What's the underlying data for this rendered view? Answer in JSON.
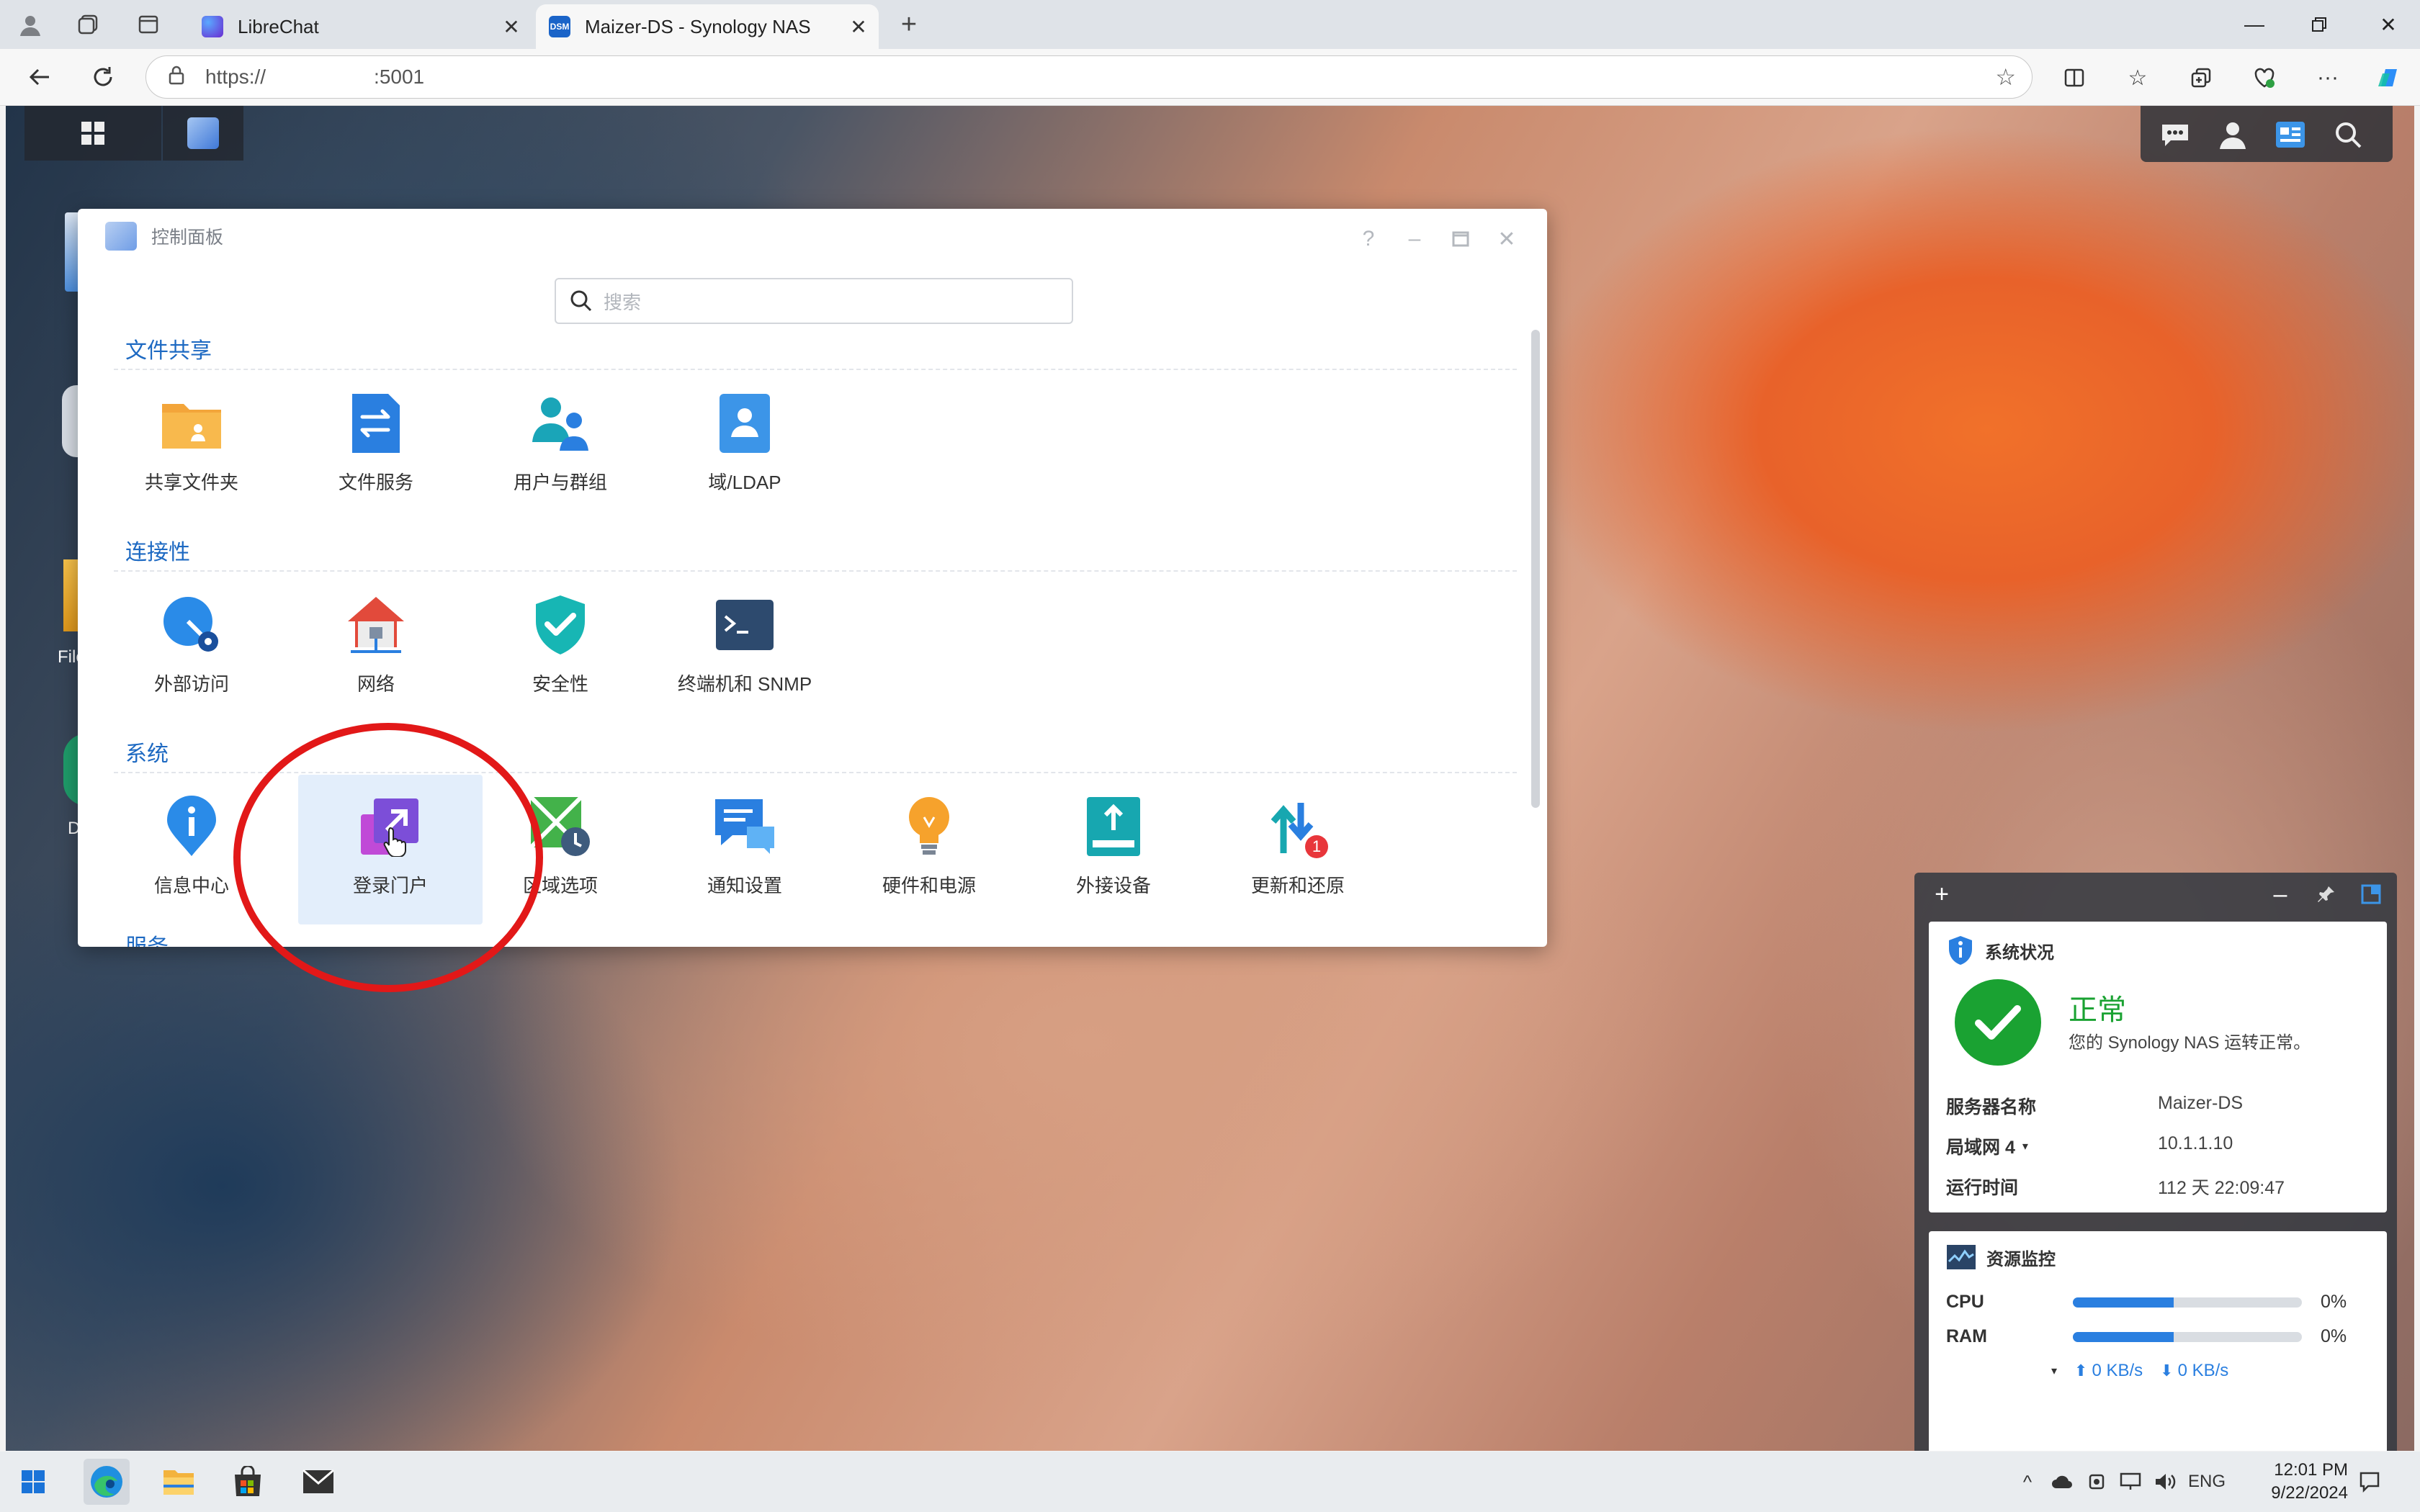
{
  "browser": {
    "tabs": [
      {
        "title": "LibreChat",
        "active": false
      },
      {
        "title": "Maizer-DS - Synology NAS",
        "active": true
      }
    ],
    "url_scheme": "https://",
    "url_port": ":5001"
  },
  "control_panel": {
    "title": "控制面板",
    "search_placeholder": "搜索",
    "sections": [
      {
        "title": "文件共享",
        "items": [
          "共享文件夹",
          "文件服务",
          "用户与群组",
          "域/LDAP"
        ]
      },
      {
        "title": "连接性",
        "items": [
          "外部访问",
          "网络",
          "安全性",
          "终端机和 SNMP"
        ]
      },
      {
        "title": "系统",
        "items": [
          "信息中心",
          "登录门户",
          "区域选项",
          "通知设置",
          "硬件和电源",
          "外接设备",
          "更新和还原"
        ]
      }
    ],
    "update_badge": "1",
    "next_section_partial": "服务",
    "selected_item": "登录门户"
  },
  "widgets": {
    "system_status": {
      "title": "系统状况",
      "status": "正常",
      "message": "您的 Synology NAS 运转正常。",
      "rows": [
        {
          "key": "服务器名称",
          "value": "Maizer-DS"
        },
        {
          "key": "局域网 4",
          "value": "10.1.1.10"
        },
        {
          "key": "运行时间",
          "value": "112 天 22:09:47"
        }
      ]
    },
    "resource_monitor": {
      "title": "资源监控",
      "cpu_label": "CPU",
      "cpu_value": "0%",
      "ram_label": "RAM",
      "ram_value": "0%",
      "cpu_fill": 0.44,
      "ram_fill": 0.44,
      "upload": "0 KB/s",
      "download": "0 KB/s"
    }
  },
  "desktop_peek": {
    "label1": "File",
    "label2": "D"
  },
  "taskbar": {
    "lang": "ENG",
    "time": "12:01 PM",
    "date": "9/22/2024"
  },
  "colors": {
    "accent": "#1d69c2",
    "status_green": "#1aa232",
    "highlight_red": "#e21818"
  }
}
